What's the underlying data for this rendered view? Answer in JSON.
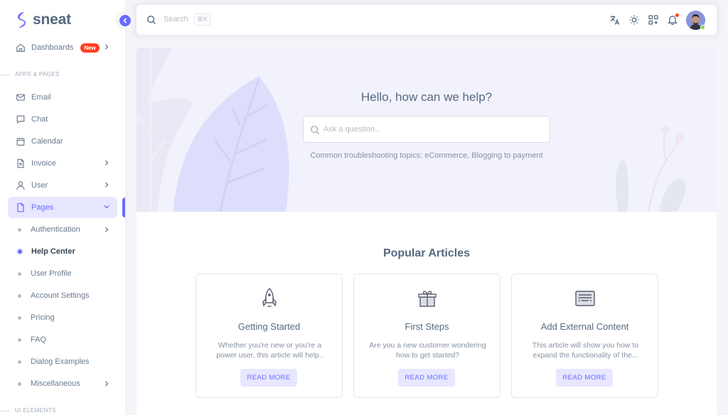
{
  "brand": {
    "name": "sneat",
    "accent": "#696cff"
  },
  "sidebar": {
    "dashboards": {
      "label": "Dashboards",
      "badge": "New"
    },
    "section_apps": "Apps & Pages",
    "items": [
      {
        "label": "Email",
        "icon": "mail-icon"
      },
      {
        "label": "Chat",
        "icon": "chat-icon"
      },
      {
        "label": "Calendar",
        "icon": "calendar-icon"
      },
      {
        "label": "Invoice",
        "icon": "file-icon"
      },
      {
        "label": "User",
        "icon": "user-icon"
      },
      {
        "label": "Pages",
        "icon": "page-icon"
      }
    ],
    "pages_sub": [
      {
        "label": "Authentication"
      },
      {
        "label": "Help Center"
      },
      {
        "label": "User Profile"
      },
      {
        "label": "Account Settings"
      },
      {
        "label": "Pricing"
      },
      {
        "label": "FAQ"
      },
      {
        "label": "Dialog Examples"
      },
      {
        "label": "Miscellaneous"
      }
    ],
    "section_ui": "UI Elements"
  },
  "navbar": {
    "search_placeholder": "Search",
    "search_shortcut": "⌘K"
  },
  "hero": {
    "title": "Hello, how can we help?",
    "search_placeholder": "Ask a question..",
    "subtitle": "Common troubleshooting topics: eCommerce, Blogging to payment"
  },
  "articles": {
    "title": "Popular Articles",
    "cards": [
      {
        "title": "Getting Started",
        "description": "Whether you're new or you're a power user, this article will help..",
        "button": "READ MORE",
        "icon": "rocket-icon"
      },
      {
        "title": "First Steps",
        "description": "Are you a new customer wondering how to get started?",
        "button": "READ MORE",
        "icon": "gift-icon"
      },
      {
        "title": "Add External Content",
        "description": "This article will show you how to expand the functionality of the...",
        "button": "READ MORE",
        "icon": "document-icon"
      }
    ]
  }
}
